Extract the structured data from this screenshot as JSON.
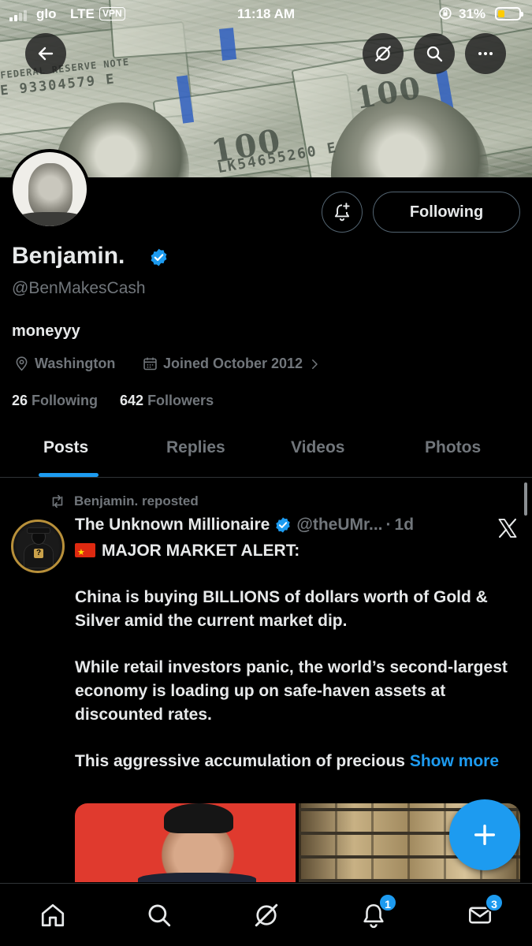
{
  "status_bar": {
    "carrier": "glo",
    "network": "LTE",
    "vpn": "VPN",
    "time": "11:18 AM",
    "battery_percent": "31%",
    "battery_level": 0.31
  },
  "banner": {
    "serial_1": "E 93304579 E",
    "serial_2": "LK54655260 E",
    "bill_text_1": "FEDERAL RESERVE NOTE",
    "bill_text_2": "100"
  },
  "profile": {
    "display_name": "Benjamin.",
    "handle": "@BenMakesCash",
    "bio": "moneyyy",
    "location": "Washington",
    "joined": "Joined October 2012",
    "following_count": "26",
    "following_label": "Following",
    "followers_count": "642",
    "followers_label": "Followers",
    "follow_button_label": "Following"
  },
  "tabs": [
    {
      "label": "Posts",
      "active": true
    },
    {
      "label": "Replies",
      "active": false
    },
    {
      "label": "Videos",
      "active": false
    },
    {
      "label": "Photos",
      "active": false
    }
  ],
  "post": {
    "repost_label": "Benjamin. reposted",
    "author_name": "The Unknown Millionaire",
    "author_handle": "@theUMr...",
    "separator": "·",
    "age": "1d",
    "headline": "MAJOR MARKET ALERT:",
    "paragraph_1": "China is buying BILLIONS of dollars worth of Gold & Silver amid the current market dip.",
    "paragraph_2": "While retail investors panic, the world’s second-largest economy is loading up on safe-haven assets at discounted rates.",
    "paragraph_3": "This aggressive accumulation of precious",
    "show_more": "Show more"
  },
  "bottom_nav": {
    "notifications_badge": "1",
    "messages_badge": "3"
  },
  "colors": {
    "accent": "#1d9bf0",
    "text_primary": "#e7e9ea",
    "text_secondary": "#71767b",
    "background": "#000000",
    "avatar_ring": "#b8903a"
  },
  "icons": [
    "back-arrow-icon",
    "grok-icon",
    "search-icon",
    "more-icon",
    "notification-bell-plus-icon",
    "verified-icon",
    "location-pin-icon",
    "calendar-icon",
    "chevron-right-icon",
    "repost-icon",
    "x-logo-icon",
    "plus-icon",
    "home-icon",
    "grok-nav-icon",
    "bell-icon",
    "mail-icon"
  ]
}
